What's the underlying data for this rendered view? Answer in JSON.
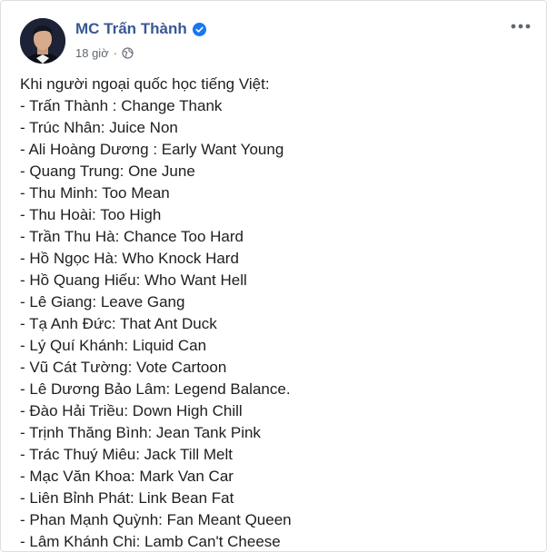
{
  "post": {
    "author": "MC Trấn Thành",
    "time": "18 giờ",
    "separator": "·",
    "verified_icon": "verified-check-icon",
    "privacy_icon": "globe-icon",
    "more_icon": "more-options-icon",
    "intro": "Khi người ngoại quốc học tiếng Việt:",
    "lines": [
      "- Trấn Thành : Change Thank",
      "- Trúc Nhân: Juice Non",
      "- Ali Hoàng Dương : Early Want Young",
      "- Quang Trung: One June",
      "- Thu Minh: Too Mean",
      "- Thu Hoài: Too High",
      "- Trần Thu Hà: Chance Too Hard",
      "- Hồ Ngọc Hà: Who Knock Hard",
      "- Hồ Quang Hiếu: Who Want Hell",
      "- Lê Giang: Leave Gang",
      "- Tạ Anh Đức: That Ant Duck",
      "- Lý Quí Khánh: Liquid Can",
      "- Vũ Cát Tường: Vote Cartoon",
      "- Lê Dương Bảo Lâm: Legend Balance.",
      "- Đào Hải Triều: Down High Chill",
      "- Trịnh Thăng Bình: Jean Tank Pink",
      "- Trác Thuý Miêu: Jack Till Melt",
      "- Mạc Văn Khoa: Mark Van Car",
      "- Liên Bỉnh Phát: Link Bean Fat",
      "- Phan Mạnh Quỳnh: Fan Meant Queen",
      "- Lâm Khánh Chi: Lamb Can't Cheese"
    ]
  },
  "colors": {
    "author_name": "#385898",
    "text": "#1c1e21",
    "meta": "#606770",
    "verified": "#1877f2"
  }
}
